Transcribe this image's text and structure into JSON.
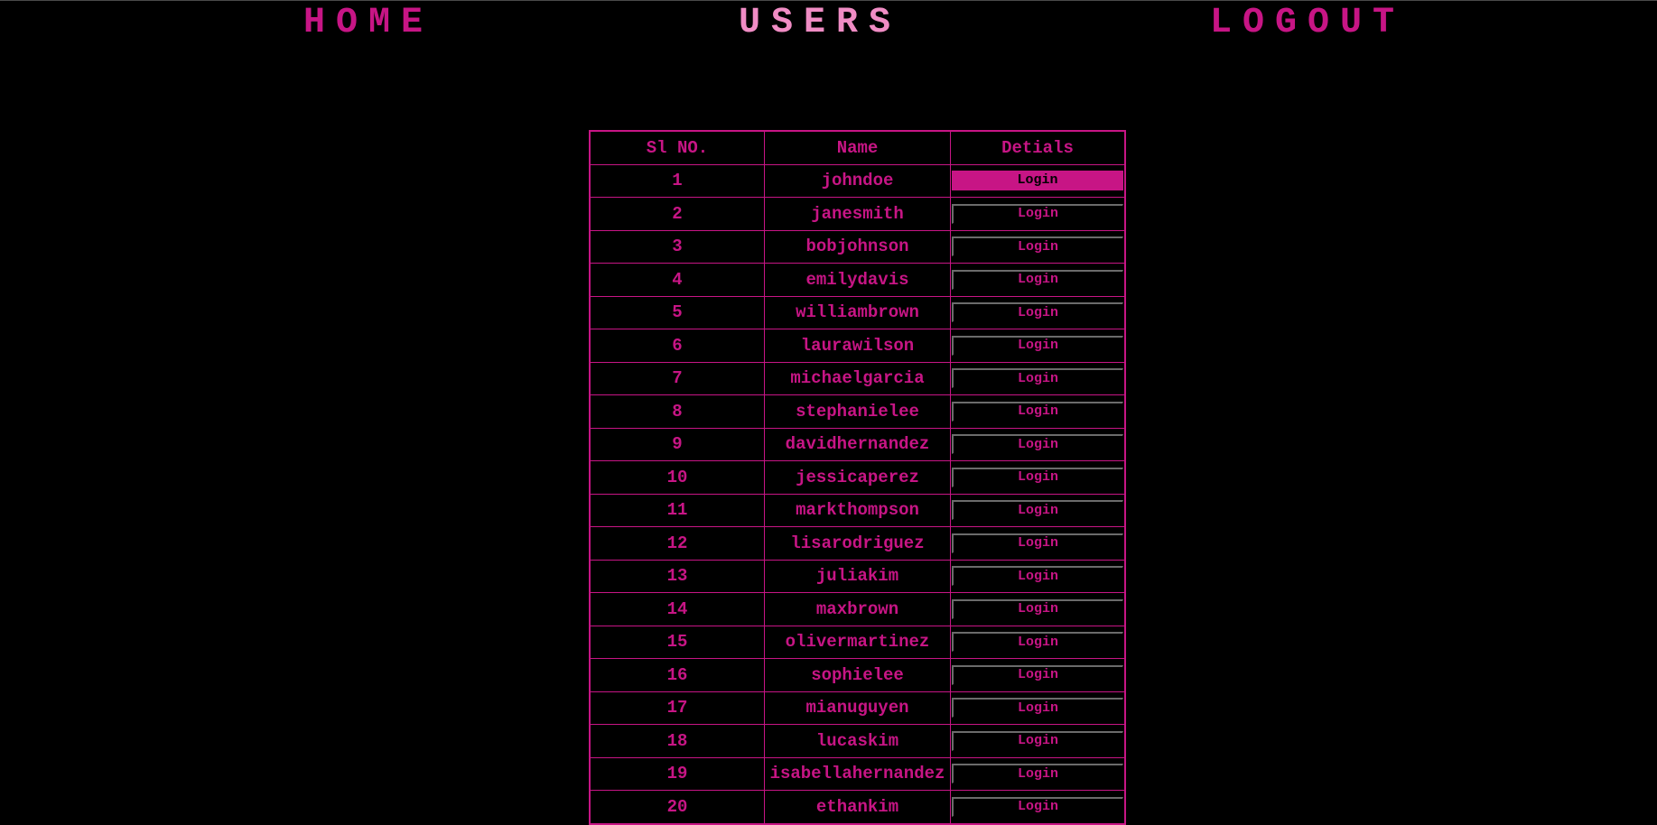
{
  "nav": {
    "home": "HOME",
    "users": "USERS",
    "logout": "LOGOUT"
  },
  "colors": {
    "accent": "#c71585",
    "active_nav": "#f08cc4",
    "background": "#000000"
  },
  "table": {
    "headers": [
      "Sl NO.",
      "Name",
      "Detials"
    ],
    "rows": [
      {
        "sl": "1",
        "name": "johndoe",
        "action": "Login"
      },
      {
        "sl": "2",
        "name": "janesmith",
        "action": "Login"
      },
      {
        "sl": "3",
        "name": "bobjohnson",
        "action": "Login"
      },
      {
        "sl": "4",
        "name": "emilydavis",
        "action": "Login"
      },
      {
        "sl": "5",
        "name": "williambrown",
        "action": "Login"
      },
      {
        "sl": "6",
        "name": "laurawilson",
        "action": "Login"
      },
      {
        "sl": "7",
        "name": "michaelgarcia",
        "action": "Login"
      },
      {
        "sl": "8",
        "name": "stephanielee",
        "action": "Login"
      },
      {
        "sl": "9",
        "name": "davidhernandez",
        "action": "Login"
      },
      {
        "sl": "10",
        "name": "jessicaperez",
        "action": "Login"
      },
      {
        "sl": "11",
        "name": "markthompson",
        "action": "Login"
      },
      {
        "sl": "12",
        "name": "lisarodriguez",
        "action": "Login"
      },
      {
        "sl": "13",
        "name": "juliakim",
        "action": "Login"
      },
      {
        "sl": "14",
        "name": "maxbrown",
        "action": "Login"
      },
      {
        "sl": "15",
        "name": "olivermartinez",
        "action": "Login"
      },
      {
        "sl": "16",
        "name": "sophielee",
        "action": "Login"
      },
      {
        "sl": "17",
        "name": "mianuguyen",
        "action": "Login"
      },
      {
        "sl": "18",
        "name": "lucaskim",
        "action": "Login"
      },
      {
        "sl": "19",
        "name": "isabellahernandez",
        "action": "Login"
      },
      {
        "sl": "20",
        "name": "ethankim",
        "action": "Login"
      }
    ]
  }
}
